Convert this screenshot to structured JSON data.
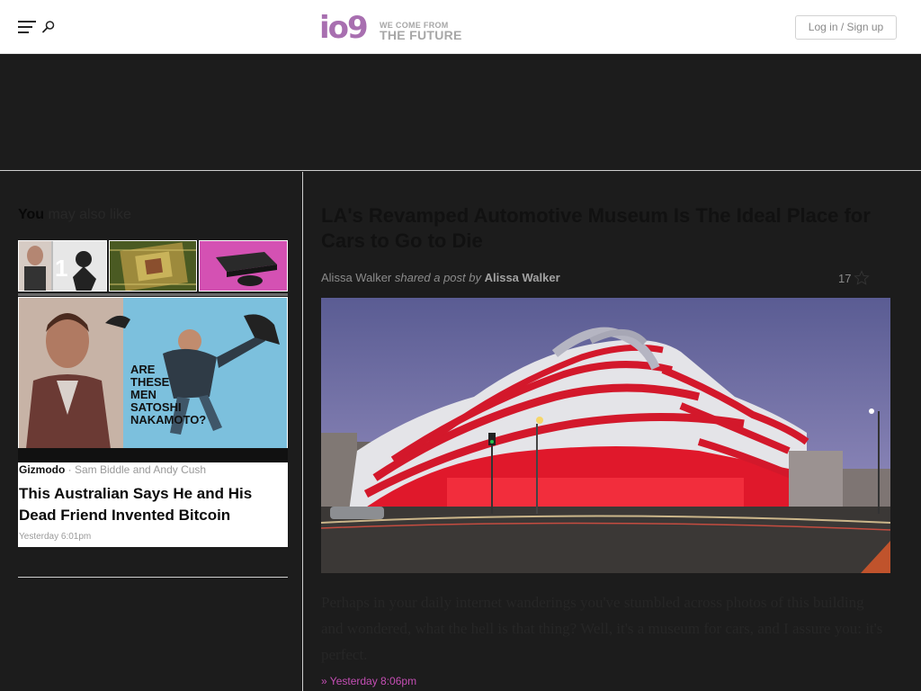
{
  "header": {
    "logo_mark": "io9",
    "logo_tag_small": "WE COME FROM",
    "logo_tag_big": "THE FUTURE",
    "login_label": "Log in / Sign up",
    "menu_icon": "hamburger-icon",
    "search_icon": "search-icon"
  },
  "sidebar": {
    "heading_strong": "You",
    "heading_rest": " may also like",
    "thumb_number": "1",
    "card": {
      "source": "Gizmodo",
      "authors": " · Sam Biddle and Andy Cush",
      "title": "This Australian Says He and His Dead Friend Invented Bitcoin",
      "time": "Yesterday 6:01pm",
      "image_caption": "ARE THESE MEN SATOSHI NAKAMOTO?"
    }
  },
  "article": {
    "title": "LA's Revamped Automotive Museum Is The Ideal Place for Cars to Go to Die",
    "author": "Alissa Walker",
    "shared_text": " shared a post by ",
    "shared_author": "Alissa Walker",
    "likes": "17",
    "body": "Perhaps in your daily internet wanderings you've stumbled across photos of this building and wondered, what the hell is that thing? Well, it's a museum for cars, and I assure you: it's perfect.",
    "time": "» Yesterday 8:06pm"
  },
  "colors": {
    "accent": "#a86fb0",
    "timestamp": "#c44eb4",
    "background": "#1c1c1c"
  }
}
